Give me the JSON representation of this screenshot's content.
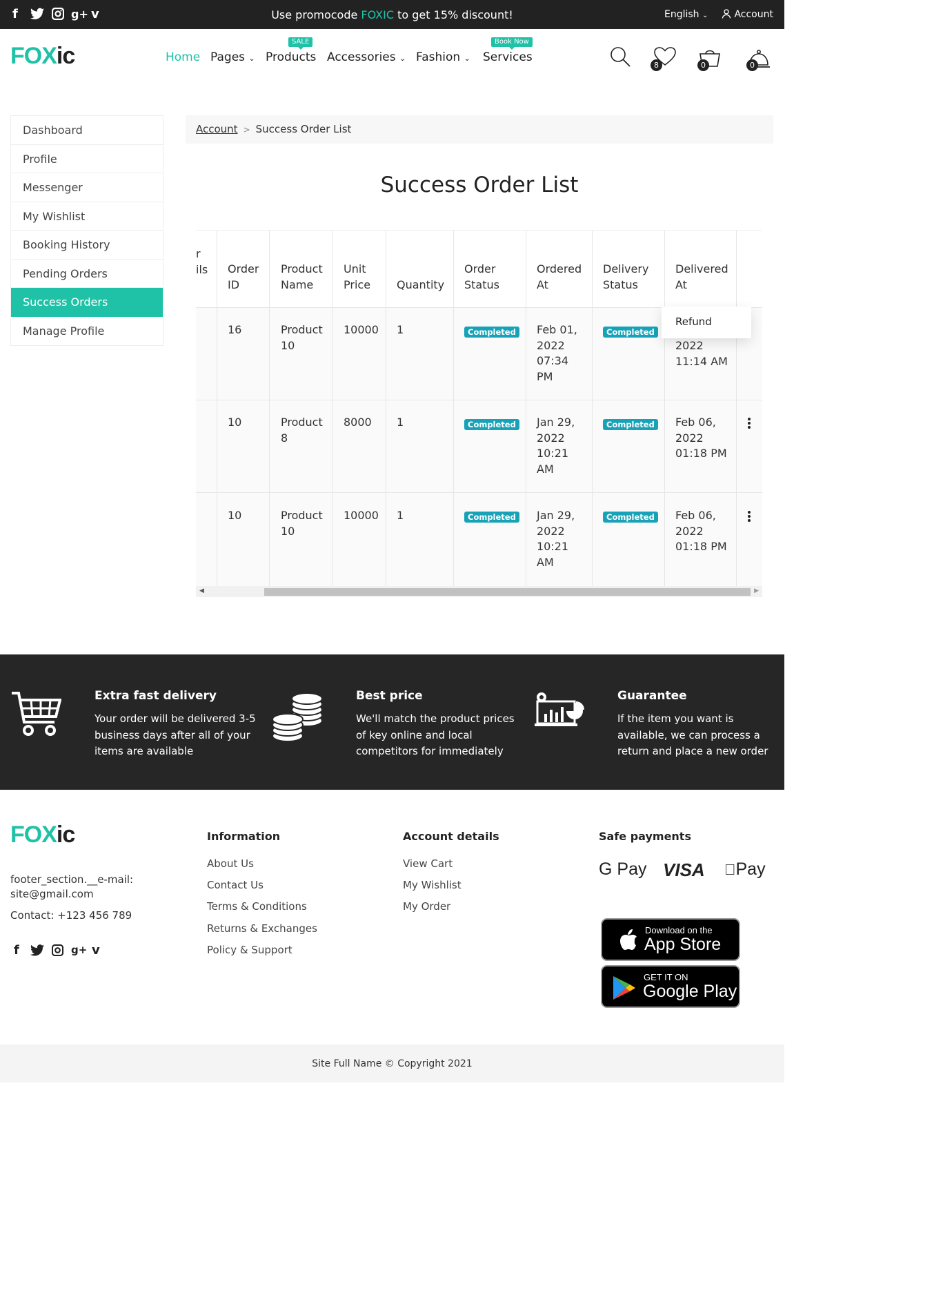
{
  "topbar": {
    "promo_prefix": "Use promocode",
    "promo_code": "FOXIC",
    "promo_suffix": "to get 15% discount!",
    "language": "English",
    "account": "Account"
  },
  "logo": {
    "part1": "FOX",
    "part2": "ic"
  },
  "nav": {
    "home": "Home",
    "pages": "Pages",
    "products": "Products",
    "products_badge": "SALE",
    "accessories": "Accessories",
    "fashion": "Fashion",
    "services": "Services",
    "services_badge": "Book Now"
  },
  "header_counts": {
    "wishlist": "8",
    "cart": "0",
    "bookings": "0"
  },
  "sidebar": {
    "items": [
      {
        "label": "Dashboard"
      },
      {
        "label": "Profile"
      },
      {
        "label": "Messenger"
      },
      {
        "label": "My Wishlist"
      },
      {
        "label": "Booking History"
      },
      {
        "label": "Pending Orders"
      },
      {
        "label": "Success Orders"
      },
      {
        "label": "Manage Profile"
      }
    ]
  },
  "breadcrumb": {
    "link": "Account",
    "current": "Success Order List"
  },
  "page_title": "Success Order List",
  "table": {
    "partial_header_1": "r",
    "partial_header_2": "ils",
    "headers": {
      "order_id": [
        "Order",
        "ID"
      ],
      "product_name": [
        "Product",
        "Name"
      ],
      "unit_price": [
        "Unit",
        "Price"
      ],
      "quantity": "Quantity",
      "order_status": [
        "Order",
        "Status"
      ],
      "ordered_at": [
        "Ordered",
        "At"
      ],
      "delivery_status": [
        "Delivery",
        "Status"
      ],
      "delivered_at": [
        "Delivered",
        "At"
      ]
    },
    "rows": [
      {
        "order_id": "16",
        "product": [
          "Product",
          "10"
        ],
        "price": "10000",
        "qty": "1",
        "order_status": "Completed",
        "ordered_at": [
          "Feb 01,",
          "2022",
          "07:34",
          "PM"
        ],
        "delivery_status": "Completed",
        "delivered_at": [
          "2022",
          "11:14 AM"
        ]
      },
      {
        "order_id": "10",
        "product": [
          "Product",
          "8"
        ],
        "price": "8000",
        "qty": "1",
        "order_status": "Completed",
        "ordered_at": [
          "Jan 29,",
          "2022",
          "10:21",
          "AM"
        ],
        "delivery_status": "Completed",
        "delivered_at": [
          "Feb 06,",
          "2022",
          "01:18 PM"
        ]
      },
      {
        "order_id": "10",
        "product": [
          "Product",
          "10"
        ],
        "price": "10000",
        "qty": "1",
        "order_status": "Completed",
        "ordered_at": [
          "Jan 29,",
          "2022",
          "10:21",
          "AM"
        ],
        "delivery_status": "Completed",
        "delivered_at": [
          "Feb 06,",
          "2022",
          "01:18 PM"
        ]
      }
    ],
    "dropdown_item": "Refund"
  },
  "features": [
    {
      "title": "Extra fast delivery",
      "text": "Your order will be delivered 3-5 business days after all of your items are available",
      "icon": "cart-icon"
    },
    {
      "title": "Best price",
      "text": "We'll match the product prices of key online and local competitors for immediately",
      "icon": "coins-icon"
    },
    {
      "title": "Guarantee",
      "text": "If the item you want is available, we can process a return and place a new order",
      "icon": "analytics-icon"
    }
  ],
  "footer": {
    "email_label": "footer_section.__e-mail:",
    "email": "site@gmail.com",
    "contact": "Contact: +123 456 789",
    "information_title": "Information",
    "information_links": [
      "About Us",
      "Contact Us",
      "Terms & Conditions",
      "Returns & Exchanges",
      "Policy & Support"
    ],
    "account_title": "Account details",
    "account_links": [
      "View Cart",
      "My Wishlist",
      "My Order"
    ],
    "payments_title": "Safe payments",
    "payments": [
      "G Pay",
      "VISA",
      "Pay"
    ],
    "appstore_small": "Download on the",
    "appstore_big": "App Store",
    "googleplay_small": "GET IT ON",
    "googleplay_big": "Google Play",
    "copyright": "Site Full Name © Copyright 2021"
  },
  "colors": {
    "accent": "#1fc2a7",
    "dark": "#222222",
    "status": "#17a2b8"
  }
}
